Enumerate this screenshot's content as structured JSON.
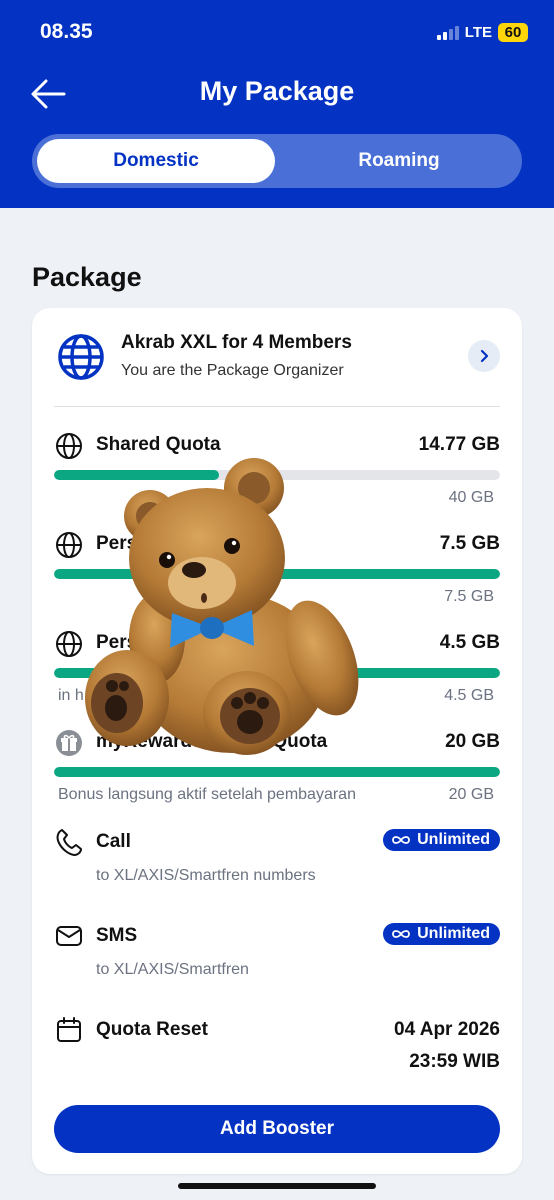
{
  "status_bar": {
    "time": "08.35",
    "network": "LTE",
    "battery": "60"
  },
  "header": {
    "title": "My Package",
    "back_icon": "arrow-left-icon"
  },
  "tabs": [
    {
      "label": "Domestic",
      "active": true
    },
    {
      "label": "Roaming",
      "active": false
    }
  ],
  "section": {
    "title": "Package"
  },
  "package": {
    "name": "Akrab XXL for 4 Members",
    "role": "You are the Package Organizer",
    "icon": "globe-icon"
  },
  "quotas": [
    {
      "label": "Shared Quota",
      "value": "14.77 GB",
      "total": "40 GB",
      "note": "",
      "fill_fraction": 0.37,
      "icon": "globe-icon"
    },
    {
      "label": "Personal Quota",
      "value": "7.5 GB",
      "total": "7.5 GB",
      "note": "",
      "fill_fraction": 1.0,
      "icon": "globe-icon"
    },
    {
      "label": "Personal Quota",
      "value": "4.5 GB",
      "total": "4.5 GB",
      "note": "in h",
      "fill_fraction": 1.0,
      "icon": "globe-icon"
    },
    {
      "label": "myRewards Bonus Quota",
      "value": "20 GB",
      "total": "20 GB",
      "note": "Bonus langsung aktif setelah pembayaran",
      "fill_fraction": 1.0,
      "icon": "gift-icon"
    }
  ],
  "services": [
    {
      "label": "Call",
      "badge": "Unlimited",
      "sub": "to XL/AXIS/Smartfren numbers",
      "icon": "phone-icon"
    },
    {
      "label": "SMS",
      "badge": "Unlimited",
      "sub": "to XL/AXIS/Smartfren",
      "icon": "envelope-icon"
    }
  ],
  "quota_reset": {
    "label": "Quota Reset",
    "date": "04 Apr 2026",
    "time": "23:59 WIB",
    "icon": "calendar-icon"
  },
  "add_booster": {
    "label": "Add Booster"
  },
  "colors": {
    "primary": "#0433c3",
    "progress": "#0aa782",
    "background": "#eef2f7"
  },
  "sticker": "teddy-bear-sticker"
}
